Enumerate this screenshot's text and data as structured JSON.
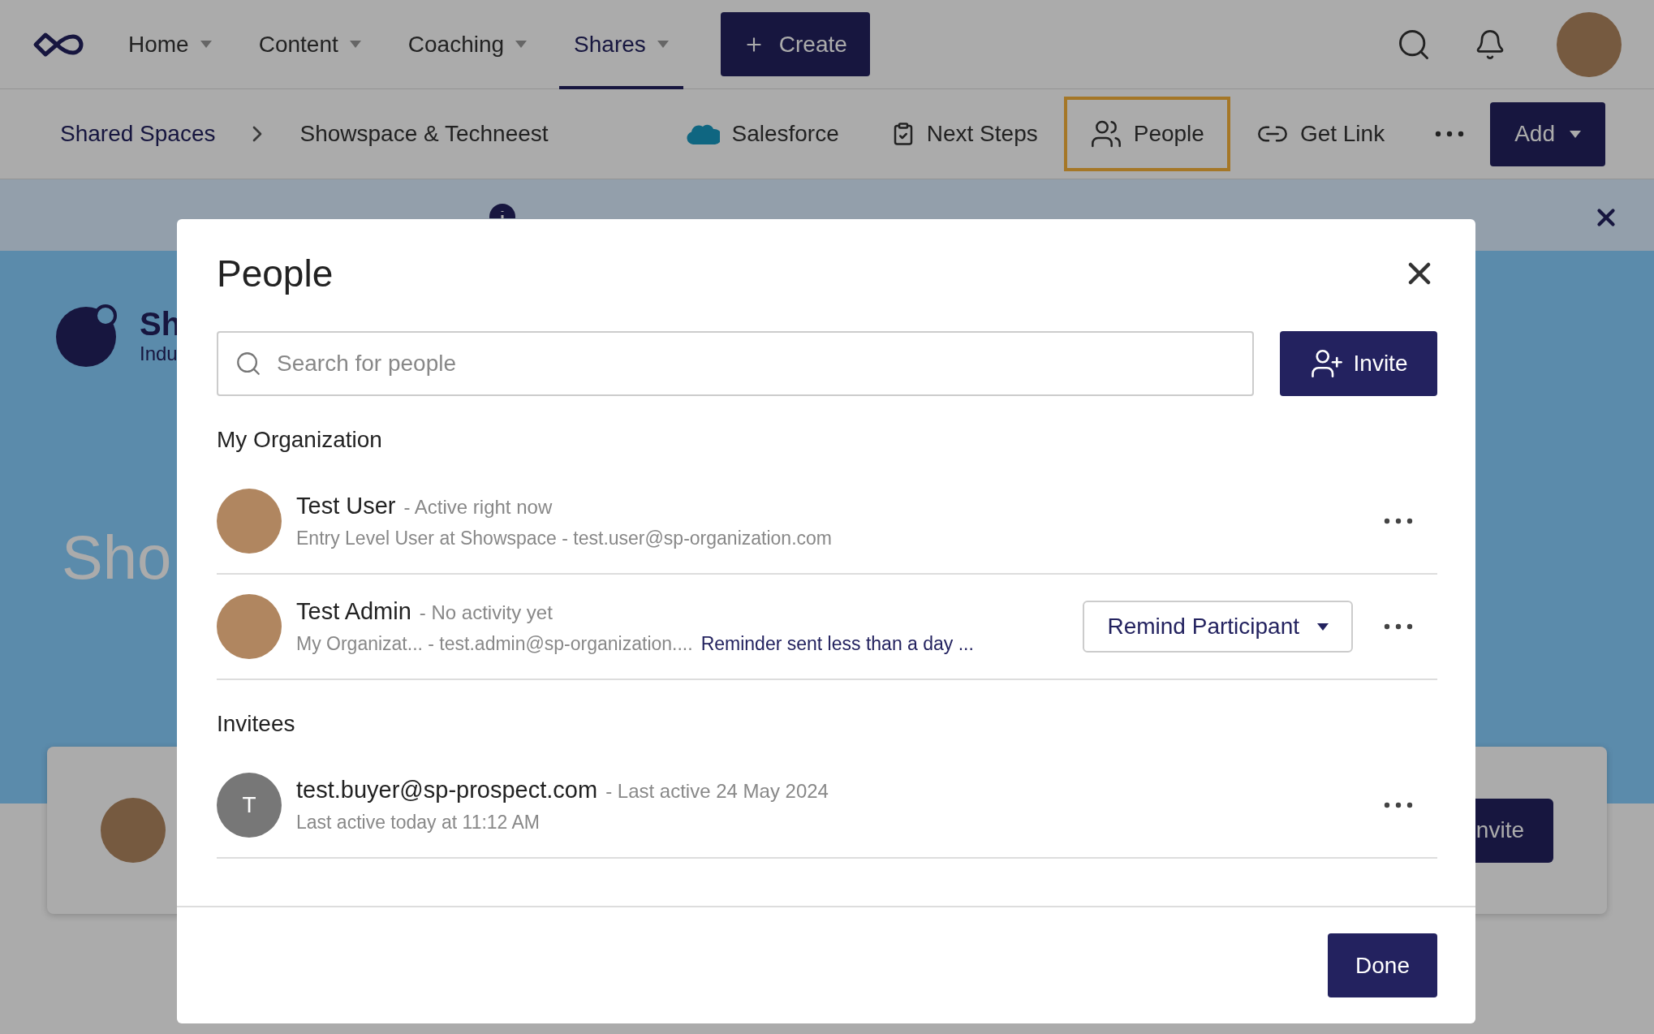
{
  "top_nav": {
    "items": [
      {
        "label": "Home",
        "selected": false
      },
      {
        "label": "Content",
        "selected": false
      },
      {
        "label": "Coaching",
        "selected": false
      },
      {
        "label": "Shares",
        "selected": true
      }
    ],
    "create_button": "Create"
  },
  "sub_nav": {
    "breadcrumb": [
      "Shared Spaces",
      "Showspace & Techneest"
    ],
    "actions": [
      {
        "label": "Salesforce",
        "kind": "salesforce",
        "selected": false
      },
      {
        "label": "Next Steps",
        "kind": "steps",
        "selected": false
      },
      {
        "label": "People",
        "kind": "people",
        "selected": true
      },
      {
        "label": "Get Link",
        "kind": "link",
        "selected": false
      }
    ],
    "add_button": "Add"
  },
  "background": {
    "brand_title": "Sh",
    "brand_subtitle": "Indu",
    "heading": "Sho",
    "invite_button": "nvite"
  },
  "dialog": {
    "title": "People",
    "search": {
      "placeholder": "Search for people"
    },
    "invite_button": "Invite",
    "sections": [
      {
        "title": "My Organization",
        "people": [
          {
            "name": "Test User",
            "status": "- Active right now",
            "details": "Entry Level User at Showspace -  test.user@sp-organization.com",
            "kind": "photo"
          },
          {
            "name": "Test Admin",
            "status": "- No activity yet",
            "details": "My Organizat...  -  test.admin@sp-organization....",
            "note": "Reminder sent less than a day ...",
            "action": "Remind Participant",
            "kind": "photo"
          }
        ]
      },
      {
        "title": "Invitees",
        "people": [
          {
            "name": "test.buyer@sp-prospect.com",
            "status": "- Last active 24 May 2024",
            "details": "Last active today at 11:12 AM",
            "kind": "initial",
            "initial": "T"
          }
        ]
      }
    ],
    "done_button": "Done"
  }
}
